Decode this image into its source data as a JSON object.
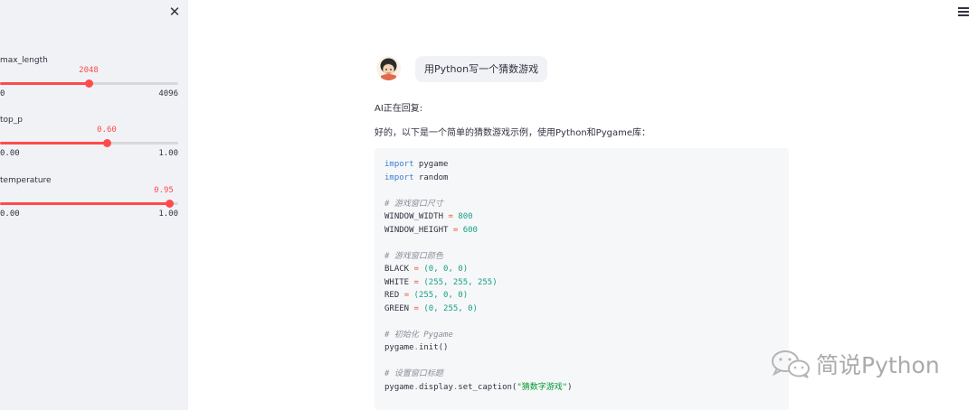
{
  "sidebar": {
    "sliders": [
      {
        "label": "max_length",
        "value": "2048",
        "min": "0",
        "max": "4096",
        "fraction": 0.5
      },
      {
        "label": "top_p",
        "value": "0.60",
        "min": "0.00",
        "max": "1.00",
        "fraction": 0.6
      },
      {
        "label": "temperature",
        "value": "0.95",
        "min": "0.00",
        "max": "1.00",
        "fraction": 0.95
      }
    ]
  },
  "chat": {
    "user_message": "用Python写一个猜数游戏",
    "status": "AI正在回复:",
    "intro": "好的，以下是一个简单的猜数游戏示例，使用Python和Pygame库：",
    "code": {
      "l1_kw": "import",
      "l1_rest": " pygame",
      "l2_kw": "import",
      "l2_rest": " random",
      "c1": "# 游戏窗口尺寸",
      "w_name": "WINDOW_WIDTH ",
      "w_eq": "=",
      "w_val": " 800",
      "h_name": "WINDOW_HEIGHT ",
      "h_eq": "=",
      "h_val": " 600",
      "c2": "# 游戏窗口颜色",
      "black_name": "BLACK ",
      "black_eq": "=",
      "black_val": " (0, 0, 0)",
      "white_name": "WHITE ",
      "white_eq": "=",
      "white_val": " (255, 255, 255)",
      "red_name": "RED ",
      "red_eq": "=",
      "red_val": " (255, 0, 0)",
      "green_name": "GREEN ",
      "green_eq": "=",
      "green_val": " (0, 255, 0)",
      "c3": "# 初始化 Pygame",
      "init_obj": "pygame",
      "init_dot": ".",
      "init_call": "init()",
      "c4": "# 设置窗口标题",
      "cap_a": "pygame",
      "cap_d1": ".",
      "cap_b": "display",
      "cap_d2": ".",
      "cap_c": "set_caption(",
      "cap_str": "\"猜数字游戏\"",
      "cap_end": ")"
    }
  },
  "watermark": {
    "text": "简说Python"
  },
  "colors": {
    "accent": "#ff4b4b",
    "sidebar_bg": "#f0f2f6",
    "code_bg": "#f6f7f9"
  }
}
